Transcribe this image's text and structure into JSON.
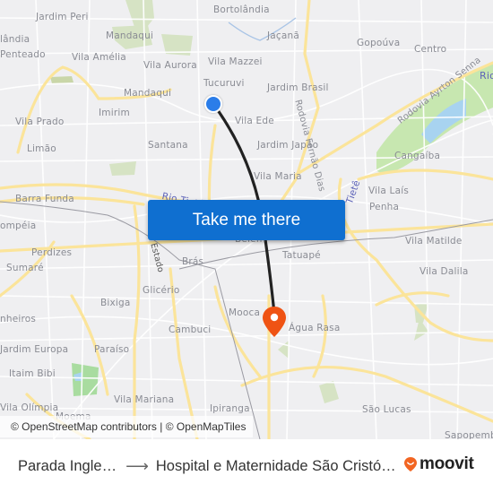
{
  "map": {
    "labels": [
      {
        "text": "Jardim Peri",
        "kind": "district"
      },
      {
        "text": "Bortolândia",
        "kind": "district"
      },
      {
        "text": "Mandaqui",
        "kind": "district"
      },
      {
        "text": "Jaçanã",
        "kind": "district"
      },
      {
        "text": "Gopoúva",
        "kind": "district"
      },
      {
        "text": "Centro",
        "kind": "district"
      },
      {
        "text": "lândia",
        "kind": "district"
      },
      {
        "text": "Penteado",
        "kind": "district"
      },
      {
        "text": "Vila Amélia",
        "kind": "district"
      },
      {
        "text": "Vila Aurora",
        "kind": "district"
      },
      {
        "text": "Vila Mazzei",
        "kind": "district"
      },
      {
        "text": "Tucuruvi",
        "kind": "district"
      },
      {
        "text": "Mandaqui",
        "kind": "district"
      },
      {
        "text": "Jardim Brasil",
        "kind": "district"
      },
      {
        "text": "Imirim",
        "kind": "district"
      },
      {
        "text": "Vila Prado",
        "kind": "district"
      },
      {
        "text": "Vila Ede",
        "kind": "district"
      },
      {
        "text": "Limão",
        "kind": "district"
      },
      {
        "text": "Santana",
        "kind": "district"
      },
      {
        "text": "Jardim Japão",
        "kind": "district"
      },
      {
        "text": "Cangaíba",
        "kind": "district"
      },
      {
        "text": "Vila Maria",
        "kind": "district"
      },
      {
        "text": "Barra Funda",
        "kind": "district"
      },
      {
        "text": "Vila Laís",
        "kind": "district"
      },
      {
        "text": "Penha",
        "kind": "district"
      },
      {
        "text": "ompéia",
        "kind": "district"
      },
      {
        "text": "Belém",
        "kind": "district"
      },
      {
        "text": "Vila Matilde",
        "kind": "district"
      },
      {
        "text": "Perdizes",
        "kind": "district"
      },
      {
        "text": "Tatuapé",
        "kind": "district"
      },
      {
        "text": "Sumaré",
        "kind": "district"
      },
      {
        "text": "Brás",
        "kind": "district"
      },
      {
        "text": "Vila Dalila",
        "kind": "district"
      },
      {
        "text": "Glicério",
        "kind": "district"
      },
      {
        "text": "nheiros",
        "kind": "district"
      },
      {
        "text": "Bixiga",
        "kind": "district"
      },
      {
        "text": "Mooca",
        "kind": "district"
      },
      {
        "text": "Água Rasa",
        "kind": "district"
      },
      {
        "text": "Cambuci",
        "kind": "district"
      },
      {
        "text": "Jardim Europa",
        "kind": "district"
      },
      {
        "text": "Paraíso",
        "kind": "district"
      },
      {
        "text": "Itaim Bibi",
        "kind": "district"
      },
      {
        "text": "Vila Mariana",
        "kind": "district"
      },
      {
        "text": "Ipiranga",
        "kind": "district"
      },
      {
        "text": "Vila Olímpia",
        "kind": "district"
      },
      {
        "text": "São Lucas",
        "kind": "district"
      },
      {
        "text": "Sapopemba",
        "kind": "district"
      },
      {
        "text": "Moema",
        "kind": "district"
      },
      {
        "text": "Rodovia Fernão Dias",
        "kind": "road"
      },
      {
        "text": "Rodovia Ayrton Senna",
        "kind": "road"
      },
      {
        "text": "Rio Tietê",
        "kind": "water"
      },
      {
        "text": "Rio",
        "kind": "water"
      },
      {
        "text": "Tietê",
        "kind": "water"
      },
      {
        "text": "Estado",
        "kind": "road"
      }
    ],
    "origin_marker": {
      "label": "origin",
      "color": "#2b7de9"
    },
    "destination_marker": {
      "label": "destination",
      "color": "#ef5314"
    },
    "route_color": "#222222",
    "attribution": "© OpenStreetMap contributors | © OpenMapTiles"
  },
  "cta": {
    "label": "Take me there",
    "color": "#0f6fd0"
  },
  "footer": {
    "origin": "Parada Ingle…",
    "arrow": "⟶",
    "destination": "Hospital e Maternidade São Cristó…",
    "brand": "moovit",
    "brand_color": "#f26522"
  }
}
